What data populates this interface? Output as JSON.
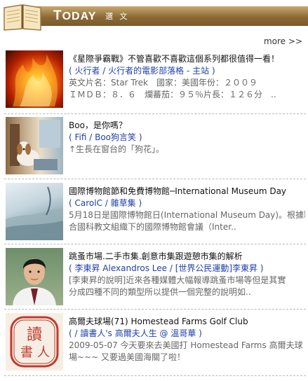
{
  "header": {
    "title_first": "T",
    "title_rest": "ODAY",
    "subtitle": "選 文"
  },
  "more_link": "more >>",
  "items": [
    {
      "title": "《星際爭霸戰》不管喜歡不喜歡這個系列都很值得一看！",
      "source": "( 火行者 / 火行者的電影部落格 - 主站 )",
      "desc1": "英文片名：Star Trek　國家：美國年份：２００９",
      "desc2": "ＩＭＤＢ：８．６　爛蕃茄：９５％片長：１２６分　.."
    },
    {
      "title": "Boo，是你嗎？",
      "source": "( Fifi / Boo狗言笑 )",
      "desc1": "↑生長在窗台的「狗花」。",
      "desc2": ""
    },
    {
      "title": "國際博物館節和免費博物館─International Museum Day",
      "source": "( CarolC / 雜草集 )",
      "desc1": "5月18日是國際博物館日(International Museum Day)。根據聯",
      "desc2": "合國科教文組織下的國際博物館會議（Inter.."
    },
    {
      "title": "跳蚤市場.二手市集.創意市集跟遊憩市集的解析",
      "source": "( 李東昇 Alexandros Lee / [世界公民運動]李東昇 )",
      "desc1": "[李東昇的說明]近來各種媒體大幅報導跳蚤市場等但是其實",
      "desc2": "分成四種不同的類型所以提供一個完整的說明如.."
    },
    {
      "title": "高爾夫球場(71) Homestead Farms Golf Club",
      "source": "( / 讀書人's 高爾夫人生 @ 溫哥華 )",
      "desc1": "2009-05-07 今天要來去美國打 Homestead Farms 高爾夫球",
      "desc2": "場~~~ 又要過美國海關了啦！"
    }
  ],
  "stamp_text": "讀書人"
}
